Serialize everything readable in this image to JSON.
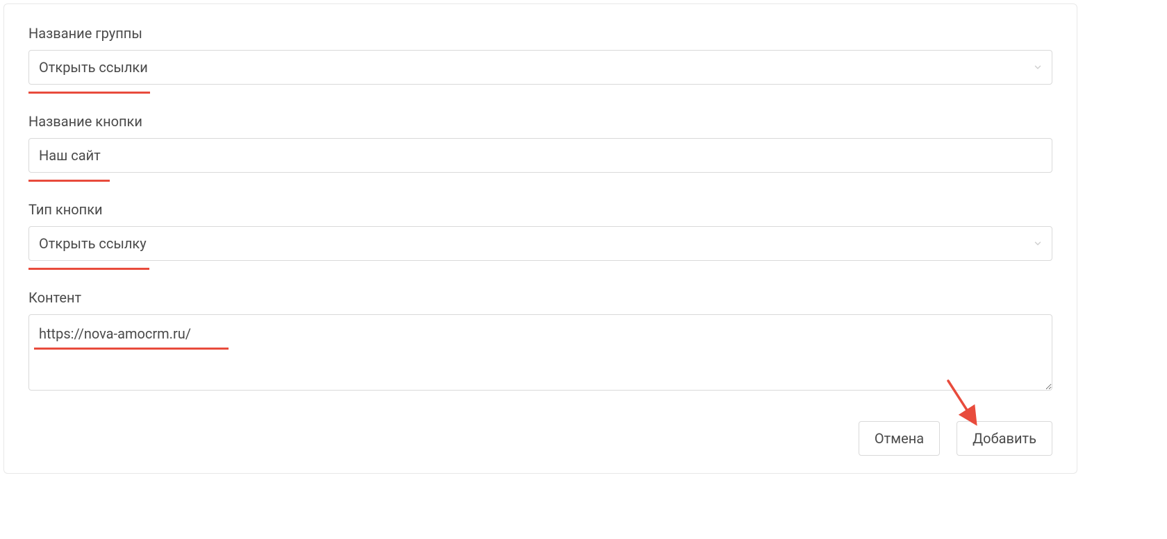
{
  "form": {
    "group_name": {
      "label": "Название группы",
      "value": "Открыть ссылки"
    },
    "button_name": {
      "label": "Название кнопки",
      "value": "Наш сайт"
    },
    "button_type": {
      "label": "Тип кнопки",
      "value": "Открыть ссылку"
    },
    "content": {
      "label": "Контент",
      "value": "https://nova-amocrm.ru/"
    }
  },
  "actions": {
    "cancel_label": "Отмена",
    "submit_label": "Добавить"
  },
  "colors": {
    "accent": "#e84b3c",
    "border": "#d9d9d9",
    "text": "#4a4a4a"
  }
}
